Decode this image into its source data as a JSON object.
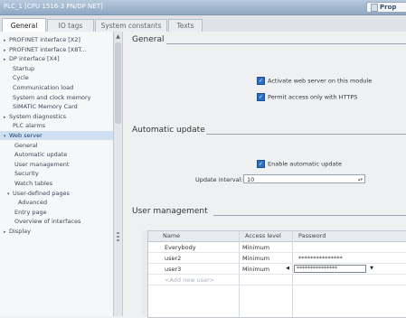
{
  "titlebar": {
    "title": "PLC_1 [CPU 1516-3 PN/DP NET]",
    "properties_tab": "Prop"
  },
  "tabs": [
    "General",
    "IO tags",
    "System constants",
    "Texts"
  ],
  "tree": [
    {
      "label": "PROFINET interface [X2]",
      "arrow": "▸",
      "indent": 0
    },
    {
      "label": "PROFINET interface [X8T...",
      "arrow": "▸",
      "indent": 0
    },
    {
      "label": "DP interface [X4]",
      "arrow": "▸",
      "indent": 0
    },
    {
      "label": "Startup",
      "arrow": "",
      "indent": 1
    },
    {
      "label": "Cycle",
      "arrow": "",
      "indent": 1
    },
    {
      "label": "Communication load",
      "arrow": "",
      "indent": 1
    },
    {
      "label": "System and clock memory",
      "arrow": "",
      "indent": 1
    },
    {
      "label": "SIMATIC Memory Card",
      "arrow": "",
      "indent": 1
    },
    {
      "label": "System diagnostics",
      "arrow": "▸",
      "indent": 0
    },
    {
      "label": "PLC alarms",
      "arrow": "",
      "indent": 1
    },
    {
      "label": "Web server",
      "arrow": "▾",
      "indent": 0
    },
    {
      "label": "General",
      "arrow": "",
      "indent": 2
    },
    {
      "label": "Automatic update",
      "arrow": "",
      "indent": 2
    },
    {
      "label": "User management",
      "arrow": "",
      "indent": 2
    },
    {
      "label": "Security",
      "arrow": "",
      "indent": 2
    },
    {
      "label": "Watch tables",
      "arrow": "",
      "indent": 2
    },
    {
      "label": "User-defined pages",
      "arrow": "▾",
      "indent": 1
    },
    {
      "label": "Advanced",
      "arrow": "",
      "indent": 3
    },
    {
      "label": "Entry page",
      "arrow": "",
      "indent": 2
    },
    {
      "label": "Overview of interfaces",
      "arrow": "",
      "indent": 2
    },
    {
      "label": "Display",
      "arrow": "▸",
      "indent": 0
    }
  ],
  "selected_tree_index": 10,
  "general": {
    "heading": "General",
    "cb_activate": "Activate web server on this module",
    "cb_https": "Permit access only with HTTPS"
  },
  "auto_update": {
    "heading": "Automatic update",
    "cb_enable": "Enable automatic update",
    "interval_label": "Update interval:",
    "interval_value": "10"
  },
  "users": {
    "heading": "User management",
    "columns": [
      "Name",
      "Access level",
      "Password"
    ],
    "rows": [
      {
        "name": "Everybody",
        "access": "Minimum",
        "password": ""
      },
      {
        "name": "user2",
        "access": "Minimum",
        "password": "***************"
      },
      {
        "name": "user3",
        "access": "Minimum",
        "password": "***************"
      }
    ],
    "add_new": "<Add new user>"
  }
}
